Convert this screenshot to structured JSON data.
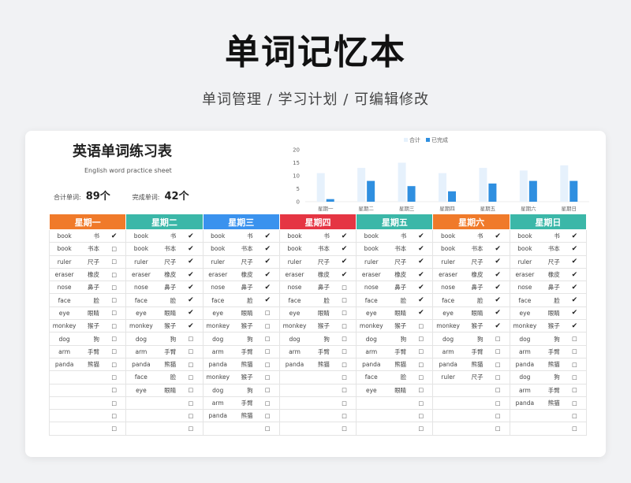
{
  "header": {
    "title": "单词记忆本",
    "subtitle": "单词管理 / 学习计划 / 可编辑修改"
  },
  "sheet": {
    "title": "英语单词练习表",
    "subtitle": "English word practice sheet",
    "total_label": "合计单词:",
    "total_value": "89个",
    "done_label": "完成单词:",
    "done_value": "42个"
  },
  "chart_data": {
    "type": "bar",
    "categories": [
      "星期一",
      "星期二",
      "星期三",
      "星期四",
      "星期五",
      "星期六",
      "星期日"
    ],
    "series": [
      {
        "name": "合计",
        "values": [
          11,
          13,
          15,
          11,
          13,
          12,
          14
        ],
        "color": "#e6f1fc"
      },
      {
        "name": "已完成",
        "values": [
          1,
          8,
          6,
          4,
          7,
          8,
          8
        ],
        "color": "#2f8fe0"
      }
    ],
    "yticks": [
      0,
      5,
      10,
      15,
      20
    ],
    "ylim": [
      0,
      20
    ],
    "legend": "top-center"
  },
  "check_symbols": {
    "done": "✔",
    "todo": "□"
  },
  "days": [
    {
      "name": "星期一",
      "color": "#f07a2a",
      "words": [
        [
          "book",
          "书",
          1
        ],
        [
          "book",
          "书本",
          0
        ],
        [
          "ruler",
          "尺子",
          0
        ],
        [
          "eraser",
          "橡皮",
          0
        ],
        [
          "nose",
          "鼻子",
          0
        ],
        [
          "face",
          "脸",
          0
        ],
        [
          "eye",
          "眼睛",
          0
        ],
        [
          "monkey",
          "猴子",
          0
        ],
        [
          "dog",
          "狗",
          0
        ],
        [
          "arm",
          "手臂",
          0
        ],
        [
          "panda",
          "熊猫",
          0
        ],
        [
          "",
          "",
          0
        ],
        [
          "",
          "",
          0
        ],
        [
          "",
          "",
          0
        ],
        [
          "",
          "",
          0
        ],
        [
          "",
          "",
          0
        ]
      ]
    },
    {
      "name": "星期二",
      "color": "#3bb7a8",
      "words": [
        [
          "book",
          "书",
          1
        ],
        [
          "book",
          "书本",
          1
        ],
        [
          "ruler",
          "尺子",
          1
        ],
        [
          "eraser",
          "橡皮",
          1
        ],
        [
          "nose",
          "鼻子",
          1
        ],
        [
          "face",
          "脸",
          1
        ],
        [
          "eye",
          "眼睛",
          1
        ],
        [
          "monkey",
          "猴子",
          1
        ],
        [
          "dog",
          "狗",
          0
        ],
        [
          "arm",
          "手臂",
          0
        ],
        [
          "panda",
          "熊猫",
          0
        ],
        [
          "face",
          "脸",
          0
        ],
        [
          "eye",
          "眼睛",
          0
        ],
        [
          "",
          "",
          0
        ],
        [
          "",
          "",
          0
        ],
        [
          "",
          "",
          0
        ]
      ]
    },
    {
      "name": "星期三",
      "color": "#3a92ee",
      "words": [
        [
          "book",
          "书",
          1
        ],
        [
          "book",
          "书本",
          1
        ],
        [
          "ruler",
          "尺子",
          1
        ],
        [
          "eraser",
          "橡皮",
          1
        ],
        [
          "nose",
          "鼻子",
          1
        ],
        [
          "face",
          "脸",
          1
        ],
        [
          "eye",
          "眼睛",
          0
        ],
        [
          "monkey",
          "猴子",
          0
        ],
        [
          "dog",
          "狗",
          0
        ],
        [
          "arm",
          "手臂",
          0
        ],
        [
          "panda",
          "熊猫",
          0
        ],
        [
          "monkey",
          "猴子",
          0
        ],
        [
          "dog",
          "狗",
          0
        ],
        [
          "arm",
          "手臂",
          0
        ],
        [
          "panda",
          "熊猫",
          0
        ],
        [
          "",
          "",
          0
        ]
      ]
    },
    {
      "name": "星期四",
      "color": "#e53543",
      "words": [
        [
          "book",
          "书",
          1
        ],
        [
          "book",
          "书本",
          1
        ],
        [
          "ruler",
          "尺子",
          1
        ],
        [
          "eraser",
          "橡皮",
          1
        ],
        [
          "nose",
          "鼻子",
          0
        ],
        [
          "face",
          "脸",
          0
        ],
        [
          "eye",
          "眼睛",
          0
        ],
        [
          "monkey",
          "猴子",
          0
        ],
        [
          "dog",
          "狗",
          0
        ],
        [
          "arm",
          "手臂",
          0
        ],
        [
          "panda",
          "熊猫",
          0
        ],
        [
          "",
          "",
          0
        ],
        [
          "",
          "",
          0
        ],
        [
          "",
          "",
          0
        ],
        [
          "",
          "",
          0
        ],
        [
          "",
          "",
          0
        ]
      ]
    },
    {
      "name": "星期五",
      "color": "#3bb7a8",
      "words": [
        [
          "book",
          "书",
          1
        ],
        [
          "book",
          "书本",
          1
        ],
        [
          "ruler",
          "尺子",
          1
        ],
        [
          "eraser",
          "橡皮",
          1
        ],
        [
          "nose",
          "鼻子",
          1
        ],
        [
          "face",
          "脸",
          1
        ],
        [
          "eye",
          "眼睛",
          1
        ],
        [
          "monkey",
          "猴子",
          0
        ],
        [
          "dog",
          "狗",
          0
        ],
        [
          "arm",
          "手臂",
          0
        ],
        [
          "panda",
          "熊猫",
          0
        ],
        [
          "face",
          "脸",
          0
        ],
        [
          "eye",
          "眼睛",
          0
        ],
        [
          "",
          "",
          0
        ],
        [
          "",
          "",
          0
        ],
        [
          "",
          "",
          0
        ]
      ]
    },
    {
      "name": "星期六",
      "color": "#f07a2a",
      "words": [
        [
          "book",
          "书",
          1
        ],
        [
          "book",
          "书本",
          1
        ],
        [
          "ruler",
          "尺子",
          1
        ],
        [
          "eraser",
          "橡皮",
          1
        ],
        [
          "nose",
          "鼻子",
          1
        ],
        [
          "face",
          "脸",
          1
        ],
        [
          "eye",
          "眼睛",
          1
        ],
        [
          "monkey",
          "猴子",
          1
        ],
        [
          "dog",
          "狗",
          0
        ],
        [
          "arm",
          "手臂",
          0
        ],
        [
          "panda",
          "熊猫",
          0
        ],
        [
          "ruler",
          "尺子",
          0
        ],
        [
          "",
          "",
          0
        ],
        [
          "",
          "",
          0
        ],
        [
          "",
          "",
          0
        ],
        [
          "",
          "",
          0
        ]
      ]
    },
    {
      "name": "星期日",
      "color": "#3bb7a8",
      "words": [
        [
          "book",
          "书",
          1
        ],
        [
          "book",
          "书本",
          1
        ],
        [
          "ruler",
          "尺子",
          1
        ],
        [
          "eraser",
          "橡皮",
          1
        ],
        [
          "nose",
          "鼻子",
          1
        ],
        [
          "face",
          "脸",
          1
        ],
        [
          "eye",
          "眼睛",
          1
        ],
        [
          "monkey",
          "猴子",
          1
        ],
        [
          "dog",
          "狗",
          0
        ],
        [
          "arm",
          "手臂",
          0
        ],
        [
          "panda",
          "熊猫",
          0
        ],
        [
          "dog",
          "狗",
          0
        ],
        [
          "arm",
          "手臂",
          0
        ],
        [
          "panda",
          "熊猫",
          0
        ],
        [
          "",
          "",
          0
        ],
        [
          "",
          "",
          0
        ]
      ]
    }
  ]
}
